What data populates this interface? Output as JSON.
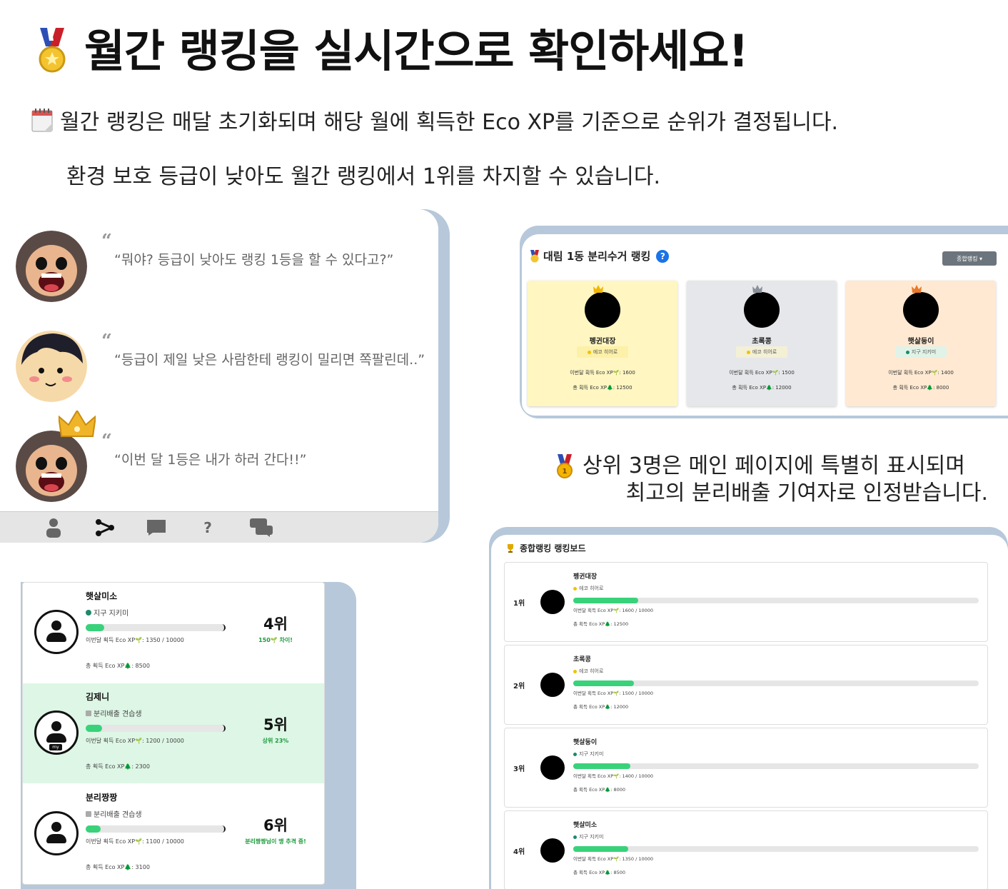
{
  "hero": {
    "title": "월간 랭킹을 실시간으로 확인하세요!",
    "desc1": "월간 랭킹은 매달 초기화되며 해당 월에 획득한 Eco XP를 기준으로 순위가 결정됩니다.",
    "desc2": "환경 보호 등급이 낮아도 월간 랭킹에서 1위를 차지할 수 있습니다."
  },
  "chat": {
    "messages": [
      {
        "mark": "“",
        "text": "“뭐야? 등급이 낮아도 랭킹 1등을 할 수 있다고?”"
      },
      {
        "mark": "“",
        "text": "“등급이 제일 낮은 사람한테 랭킹이 밀리면 쪽팔린데..”"
      },
      {
        "mark": "“",
        "text": "“이번 달 1등은 내가 하러 간다!!”"
      }
    ],
    "nav_icons": [
      "person-icon",
      "share-icon",
      "chat-icon",
      "question-icon",
      "messages-icon"
    ],
    "nav_prompt": "?"
  },
  "ranking": {
    "title": "대림 1동 분리수거 랭킹",
    "help": "?",
    "dropdown": "종합랭킹 ▾",
    "podium": [
      {
        "name": "펭귄대장",
        "grade": "에코 히어로",
        "grade_color": "#f2c200",
        "xp": "이번달 획득 Eco XP🌱: 1600",
        "total": "총 획득 Eco XP🌲: 12500",
        "bg": "#fff6c2",
        "crown_color": "#f2b600"
      },
      {
        "name": "초록콩",
        "grade": "에코 히어로",
        "grade_color": "#f2c200",
        "xp": "이번달 획득 Eco XP🌱: 1500",
        "total": "총 획득 Eco XP🌲: 12000",
        "bg": "#e6e7ea",
        "crown_color": "#8a8f99"
      },
      {
        "name": "햇살둥이",
        "grade": "지구 지키미",
        "grade_color": "#1a8a6a",
        "xp": "이번달 획득 Eco XP🌱: 1400",
        "total": "총 획득 Eco XP🌲: 8000",
        "bg": "#ffe9d2",
        "crown_color": "#e8782a"
      }
    ]
  },
  "top3": {
    "line1": "상위 3명은 메인 페이지에 특별히 표시되며",
    "line2": "최고의 분리배출 기여자로 인정받습니다."
  },
  "myrank": {
    "rows": [
      {
        "name": "햇살미소",
        "grade": "지구 지키미",
        "grade_icon": "globe-icon",
        "progress": 0.135,
        "xp": "이번달 획득 Eco XP🌱: 1350 / 10000",
        "total": "총 획득 Eco XP🌲: 8500",
        "pos": "4위",
        "note": "150🌱 차이!",
        "me": false
      },
      {
        "name": "김제니",
        "grade": "분리배출 견습생",
        "grade_icon": "bin-icon",
        "progress": 0.12,
        "xp": "이번달 획득 Eco XP🌱: 1200 / 10000",
        "total": "총 획득 Eco XP🌲: 2300",
        "pos": "5위",
        "note": "상위 23%",
        "me": true,
        "me_label": "my"
      },
      {
        "name": "분리짱짱",
        "grade": "분리배출 견습생",
        "grade_icon": "bin-icon",
        "progress": 0.11,
        "xp": "이번달 획득 Eco XP🌱: 1100 / 10000",
        "total": "총 획득 Eco XP🌲: 3100",
        "pos": "6위",
        "note": "분리짱짱님이 맹 추격 중!",
        "me": false
      }
    ]
  },
  "leaderboard": {
    "title": "종합랭킹 랭킹보드",
    "rows": [
      {
        "pos": "1위",
        "name": "펭귄대장",
        "grade": "에코 히어로",
        "grade_color": "#f2c200",
        "progress": 0.16,
        "xp": "이번달 획득 Eco XP🌱: 1600 / 10000",
        "total": "총 획득 Eco XP🌲: 12500"
      },
      {
        "pos": "2위",
        "name": "초록콩",
        "grade": "에코 히어로",
        "grade_color": "#f2c200",
        "progress": 0.15,
        "xp": "이번달 획득 Eco XP🌱: 1500 / 10000",
        "total": "총 획득 Eco XP🌲: 12000"
      },
      {
        "pos": "3위",
        "name": "햇살둥이",
        "grade": "지구 지키미",
        "grade_color": "#1a8a6a",
        "progress": 0.14,
        "xp": "이번달 획득 Eco XP🌱: 1400 / 10000",
        "total": "총 획득 Eco XP🌲: 8000"
      },
      {
        "pos": "4위",
        "name": "햇살미소",
        "grade": "지구 지키미",
        "grade_color": "#1a8a6a",
        "progress": 0.135,
        "xp": "이번달 획득 Eco XP🌱: 1350 / 10000",
        "total": "총 획득 Eco XP🌲: 8500"
      }
    ]
  },
  "colors": {
    "accent_green": "#39d27a",
    "frame_blue": "#b7c8da",
    "highlight_row": "#ddf6e5"
  }
}
